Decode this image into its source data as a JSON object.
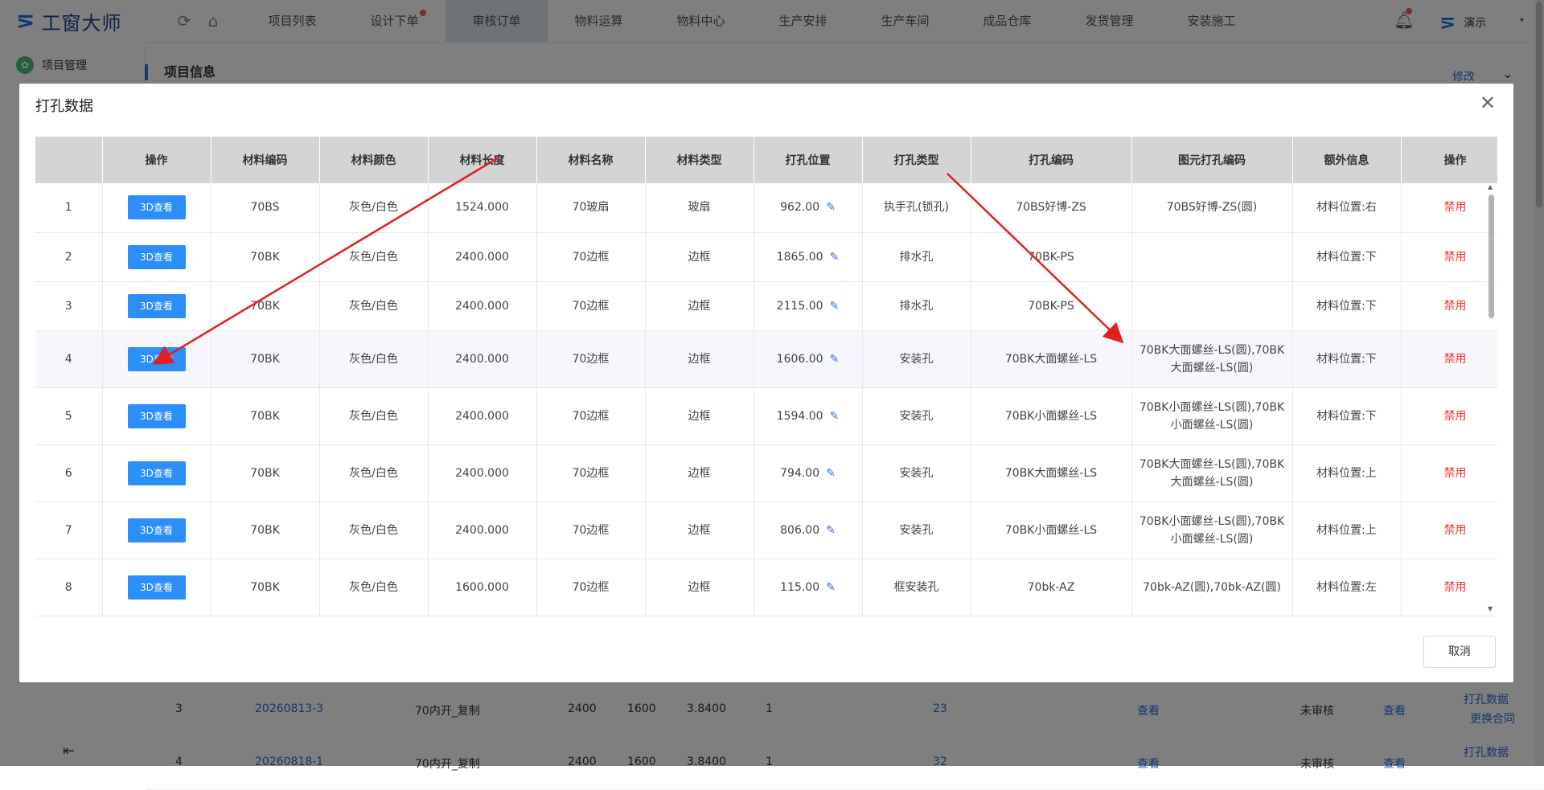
{
  "app": {
    "title": "工窗大师",
    "user_name": "演示"
  },
  "nav": {
    "items": [
      {
        "label": "项目列表",
        "active": false,
        "dot": false
      },
      {
        "label": "设计下单",
        "active": false,
        "dot": true
      },
      {
        "label": "审核订单",
        "active": true,
        "dot": false
      },
      {
        "label": "物料运算",
        "active": false,
        "dot": false
      },
      {
        "label": "物料中心",
        "active": false,
        "dot": false
      },
      {
        "label": "生产安排",
        "active": false,
        "dot": false
      },
      {
        "label": "生产车间",
        "active": false,
        "dot": false
      },
      {
        "label": "成品仓库",
        "active": false,
        "dot": false
      },
      {
        "label": "发货管理",
        "active": false,
        "dot": false
      },
      {
        "label": "安装施工",
        "active": false,
        "dot": false
      }
    ]
  },
  "sidebar": {
    "item_label": "项目管理"
  },
  "page": {
    "section_title": "项目信息",
    "edit_label": "修改"
  },
  "bg_rows": [
    {
      "no": "3",
      "order": "20260813-3",
      "name": "70内开_复制",
      "w": "2400",
      "h": "1600",
      "area": "3.8400",
      "qty": "1",
      "count": "23",
      "view": "查看",
      "status": "未审核",
      "view2": "查看",
      "a1": "打孔数据",
      "a2": "更换合同"
    },
    {
      "no": "4",
      "order": "20260818-1",
      "name": "70内开_复制",
      "w": "2400",
      "h": "1600",
      "area": "3.8400",
      "qty": "1",
      "count": "32",
      "view": "查看",
      "status": "未审核",
      "view2": "查看",
      "a1": "打孔数据",
      "a2": ""
    }
  ],
  "modal": {
    "title": "打孔数据",
    "cancel_label": "取消",
    "headers": [
      "",
      "操作",
      "材料编码",
      "材料颜色",
      "材料长度",
      "材料名称",
      "材料类型",
      "打孔位置",
      "打孔类型",
      "打孔编码",
      "图元打孔编码",
      "额外信息",
      "操作"
    ],
    "view_label": "3D查看",
    "disable_label": "禁用",
    "rows": [
      {
        "idx": "1",
        "code": "70BS",
        "color": "灰色/白色",
        "length": "1524.000",
        "name": "70玻扇",
        "type": "玻扇",
        "pos": "962.00",
        "hole_type": "执手孔(锁孔)",
        "hole_code": "70BS好博-ZS",
        "fig_code": "70BS好博-ZS(圆)",
        "extra": "材料位置:右"
      },
      {
        "idx": "2",
        "code": "70BK",
        "color": "灰色/白色",
        "length": "2400.000",
        "name": "70边框",
        "type": "边框",
        "pos": "1865.00",
        "hole_type": "排水孔",
        "hole_code": "70BK-PS",
        "fig_code": "",
        "extra": "材料位置:下"
      },
      {
        "idx": "3",
        "code": "70BK",
        "color": "灰色/白色",
        "length": "2400.000",
        "name": "70边框",
        "type": "边框",
        "pos": "2115.00",
        "hole_type": "排水孔",
        "hole_code": "70BK-PS",
        "fig_code": "",
        "extra": "材料位置:下"
      },
      {
        "idx": "4",
        "code": "70BK",
        "color": "灰色/白色",
        "length": "2400.000",
        "name": "70边框",
        "type": "边框",
        "pos": "1606.00",
        "hole_type": "安装孔",
        "hole_code": "70BK大面螺丝-LS",
        "fig_code": "70BK大面螺丝-LS(圆),70BK大面螺丝-LS(圆)",
        "extra": "材料位置:下"
      },
      {
        "idx": "5",
        "code": "70BK",
        "color": "灰色/白色",
        "length": "2400.000",
        "name": "70边框",
        "type": "边框",
        "pos": "1594.00",
        "hole_type": "安装孔",
        "hole_code": "70BK小面螺丝-LS",
        "fig_code": "70BK小面螺丝-LS(圆),70BK小面螺丝-LS(圆)",
        "extra": "材料位置:下"
      },
      {
        "idx": "6",
        "code": "70BK",
        "color": "灰色/白色",
        "length": "2400.000",
        "name": "70边框",
        "type": "边框",
        "pos": "794.00",
        "hole_type": "安装孔",
        "hole_code": "70BK大面螺丝-LS",
        "fig_code": "70BK大面螺丝-LS(圆),70BK大面螺丝-LS(圆)",
        "extra": "材料位置:上"
      },
      {
        "idx": "7",
        "code": "70BK",
        "color": "灰色/白色",
        "length": "2400.000",
        "name": "70边框",
        "type": "边框",
        "pos": "806.00",
        "hole_type": "安装孔",
        "hole_code": "70BK小面螺丝-LS",
        "fig_code": "70BK小面螺丝-LS(圆),70BK小面螺丝-LS(圆)",
        "extra": "材料位置:上"
      },
      {
        "idx": "8",
        "code": "70BK",
        "color": "灰色/白色",
        "length": "1600.000",
        "name": "70边框",
        "type": "边框",
        "pos": "115.00",
        "hole_type": "框安装孔",
        "hole_code": "70bk-AZ",
        "fig_code": "70bk-AZ(圆),70bk-AZ(圆)",
        "extra": "材料位置:左"
      }
    ]
  },
  "colors": {
    "accent": "#2c8ef8",
    "brand": "#1f6fe5",
    "danger": "#ee3a3a",
    "annotation": "#e02020"
  }
}
